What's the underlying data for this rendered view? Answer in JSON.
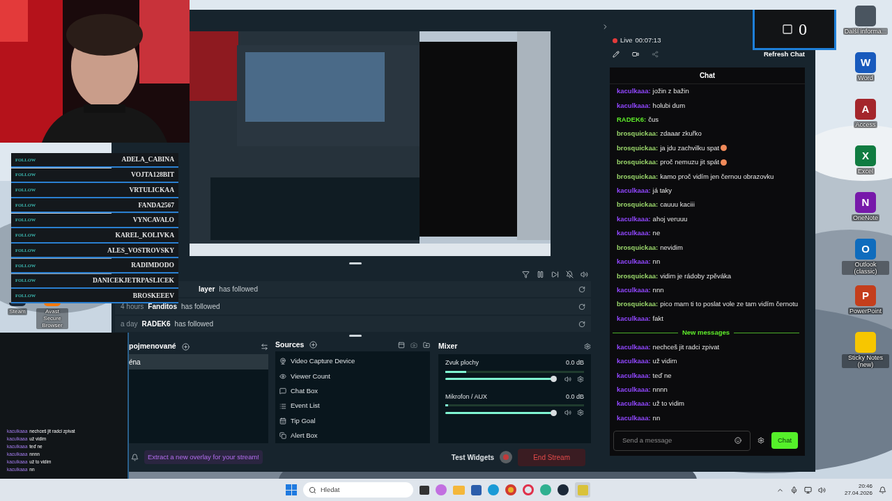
{
  "desktop_icons": [
    {
      "label": "Další informa...",
      "color": "#4a5560"
    },
    {
      "label": "Word",
      "letter": "W",
      "color": "#185abd"
    },
    {
      "label": "Access",
      "letter": "A",
      "color": "#a4262c"
    },
    {
      "label": "Excel",
      "letter": "X",
      "color": "#107c41"
    },
    {
      "label": "OneNote",
      "letter": "N",
      "color": "#7719aa"
    },
    {
      "label": "Outlook (classic)",
      "letter": "O",
      "color": "#0f6cbd"
    },
    {
      "label": "PowerPoint",
      "letter": "P",
      "color": "#c43e1c"
    },
    {
      "label": "Sticky Notes (new)",
      "color": "#f7c600"
    }
  ],
  "left_desktop_icons": [
    {
      "label": "Steam",
      "color": "#1b2838"
    },
    {
      "label": "Avast Secure Browser",
      "color": "#ff7800"
    }
  ],
  "viewer_counter": {
    "value": "0"
  },
  "follower_alerts": [
    {
      "label": "FOLLOW",
      "name": "ADELA_CABINA"
    },
    {
      "label": "FOLLOW",
      "name": "VOJTA128BIT"
    },
    {
      "label": "FOLLOW",
      "name": "VRTULICKAA"
    },
    {
      "label": "FOLLOW",
      "name": "FANDA2567"
    },
    {
      "label": "FOLLOW",
      "name": "VYNCAVALO"
    },
    {
      "label": "FOLLOW",
      "name": "KAREL_KOLIVKA"
    },
    {
      "label": "FOLLOW",
      "name": "ALES_VOSTROVSKY"
    },
    {
      "label": "FOLLOW",
      "name": "RADIMDODO"
    },
    {
      "label": "FOLLOW",
      "name": "DANICEKJETRPASLICEK"
    },
    {
      "label": "FOLLOW",
      "name": "BROSKEEEV"
    }
  ],
  "overlay_chat": [
    {
      "user": "kaculkaaa",
      "text": "nechceš jit radci zpivat"
    },
    {
      "user": "kaculkaaa",
      "text": "už vidim"
    },
    {
      "user": "kaculkaaa",
      "text": "teď ne"
    },
    {
      "user": "kaculkaaa",
      "text": "nnnn"
    },
    {
      "user": "kaculkaaa",
      "text": "už to vidim"
    },
    {
      "user": "kaculkaaa",
      "text": "nn"
    }
  ],
  "studio": {
    "events": [
      {
        "name": "layer",
        "text": "has followed"
      },
      {
        "time": "4 hours",
        "name": "Fanditos",
        "text": "has followed"
      },
      {
        "time": "a day",
        "name": "RADEK6",
        "text": "has followed"
      }
    ],
    "scenes": {
      "title": "pojmenované",
      "items": [
        {
          "name": "éna",
          "selected": true
        }
      ]
    },
    "sources": {
      "title": "Sources",
      "items": [
        {
          "kind": "camera",
          "name": "Video Capture Device"
        },
        {
          "kind": "eye",
          "name": "Viewer Count"
        },
        {
          "kind": "chat",
          "name": "Chat Box"
        },
        {
          "kind": "list",
          "name": "Event List"
        },
        {
          "kind": "goal",
          "name": "Tip Goal"
        },
        {
          "kind": "alert",
          "name": "Alert Box"
        }
      ]
    },
    "mixer": {
      "title": "Mixer",
      "channels": [
        {
          "name": "Zvuk plochy",
          "reading": "0.0 dB",
          "meter": {
            "level": 0.15
          },
          "volume": {
            "level": 0.96
          }
        },
        {
          "name": "Mikrofon / AUX",
          "reading": "0.0 dB",
          "meter": {
            "level": 0.02
          },
          "volume": {
            "level": 0.96
          }
        }
      ]
    },
    "notice": "Extract a new overlay for your stream!",
    "test_widgets": "Test Widgets",
    "end_stream": "End Stream",
    "live": {
      "label": "Live",
      "time": "00:07:13"
    },
    "refresh_chat": "Refresh Chat",
    "chat": {
      "title": "Chat",
      "items": [
        {
          "kind": "message",
          "user": "kaculkaaa:",
          "color": "#9147ff",
          "text": "jožin z bažin",
          "emoji": false
        },
        {
          "kind": "message",
          "user": "kaculkaaa:",
          "color": "#9147ff",
          "text": "holubi dum",
          "emoji": false
        },
        {
          "kind": "message",
          "user": "RADEK6:",
          "color": "#5eea2a",
          "text": "čus",
          "emoji": false
        },
        {
          "kind": "message",
          "user": "brosquickaa:",
          "color": "#9ad66b",
          "text": "zdaaar zkuřko",
          "emoji": false
        },
        {
          "kind": "message",
          "user": "brosquickaa:",
          "color": "#9ad66b",
          "text": "ja jdu zachvilku spat",
          "emoji": true
        },
        {
          "kind": "message",
          "user": "brosquickaa:",
          "color": "#9ad66b",
          "text": "proč nemuzu jit spát",
          "emoji": true
        },
        {
          "kind": "message",
          "user": "brosquickaa:",
          "color": "#9ad66b",
          "text": "kamo proč vidím jen černou obrazovku",
          "emoji": false
        },
        {
          "kind": "message",
          "user": "kaculkaaa:",
          "color": "#9147ff",
          "text": "já taky",
          "emoji": false
        },
        {
          "kind": "message",
          "user": "brosquickaa:",
          "color": "#9ad66b",
          "text": "cauuu kaciii",
          "emoji": false
        },
        {
          "kind": "message",
          "user": "kaculkaaa:",
          "color": "#9147ff",
          "text": "ahoj veruuu",
          "emoji": false
        },
        {
          "kind": "message",
          "user": "kaculkaaa:",
          "color": "#9147ff",
          "text": "ne",
          "emoji": false
        },
        {
          "kind": "message",
          "user": "brosquickaa:",
          "color": "#9ad66b",
          "text": "nevidim",
          "emoji": false
        },
        {
          "kind": "message",
          "user": "kaculkaaa:",
          "color": "#9147ff",
          "text": "nn",
          "emoji": false
        },
        {
          "kind": "message",
          "user": "brosquickaa:",
          "color": "#9ad66b",
          "text": "vidim je rádoby zpěváka",
          "emoji": false
        },
        {
          "kind": "message",
          "user": "kaculkaaa:",
          "color": "#9147ff",
          "text": "nnn",
          "emoji": false
        },
        {
          "kind": "message",
          "user": "brosquickaa:",
          "color": "#9ad66b",
          "text": "pico mam ti to poslat vole ze tam vidím černotu",
          "emoji": false
        },
        {
          "kind": "message",
          "user": "kaculkaaa:",
          "color": "#9147ff",
          "text": "fakt",
          "emoji": false
        },
        {
          "kind": "divider",
          "text": "New messages"
        },
        {
          "kind": "message",
          "user": "kaculkaaa:",
          "color": "#9147ff",
          "text": "nechceš jit radci zpivat",
          "emoji": false
        },
        {
          "kind": "message",
          "user": "kaculkaaa:",
          "color": "#9147ff",
          "text": "už vidim",
          "emoji": false
        },
        {
          "kind": "message",
          "user": "kaculkaaa:",
          "color": "#9147ff",
          "text": "teď ne",
          "emoji": false
        },
        {
          "kind": "message",
          "user": "kaculkaaa:",
          "color": "#9147ff",
          "text": "nnnn",
          "emoji": false
        },
        {
          "kind": "message",
          "user": "kaculkaaa:",
          "color": "#9147ff",
          "text": "už to vidim",
          "emoji": false
        },
        {
          "kind": "message",
          "user": "kaculkaaa:",
          "color": "#9147ff",
          "text": "nn",
          "emoji": false
        }
      ],
      "placeholder": "Send a message",
      "send": "Chat"
    }
  },
  "taskbar": {
    "search_placeholder": "Hledat",
    "time": "20:46",
    "date": "27.04.2026"
  }
}
